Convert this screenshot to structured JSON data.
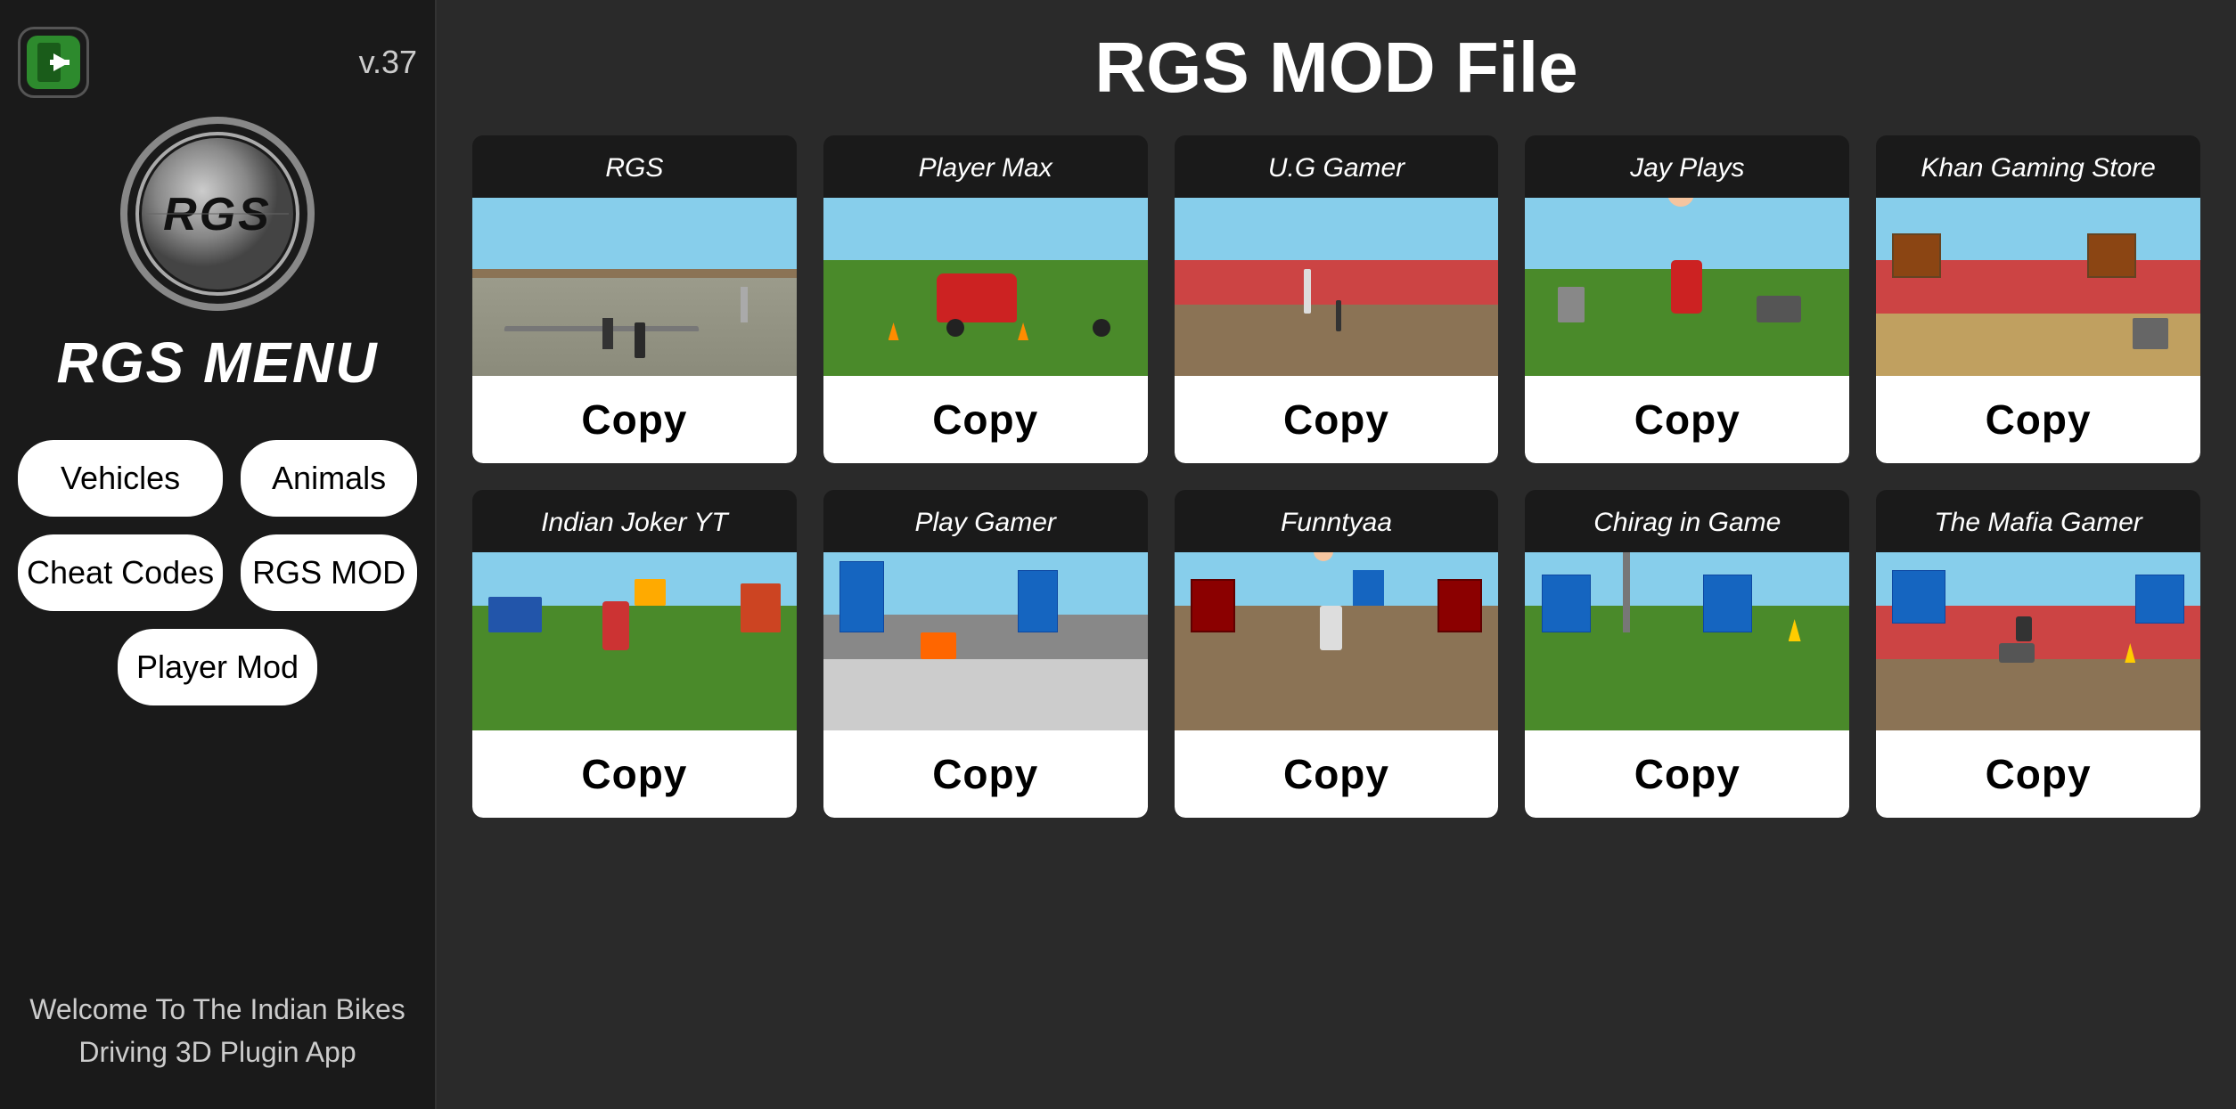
{
  "sidebar": {
    "version": "v.37",
    "menu_title": "RGS MENU",
    "buttons": [
      {
        "label": "Vehicles",
        "id": "vehicles"
      },
      {
        "label": "Animals",
        "id": "animals"
      },
      {
        "label": "Cheat Codes",
        "id": "cheat-codes"
      },
      {
        "label": "RGS MOD",
        "id": "rgs-mod"
      },
      {
        "label": "Player Mod",
        "id": "player-mod"
      }
    ],
    "welcome_text": "Welcome To The Indian Bikes\nDriving 3D Plugin App"
  },
  "main": {
    "title": "RGS MOD File",
    "cards": [
      {
        "id": "rgs",
        "name": "RGS",
        "scene": "scene-rgs",
        "copy_label": "Copy"
      },
      {
        "id": "player-max",
        "name": "Player Max",
        "scene": "scene-playermax",
        "copy_label": "Copy"
      },
      {
        "id": "ug-gamer",
        "name": "U.G Gamer",
        "scene": "scene-uggamer",
        "copy_label": "Copy"
      },
      {
        "id": "jay-plays",
        "name": "Jay Plays",
        "scene": "scene-jayplays",
        "copy_label": "Copy"
      },
      {
        "id": "khan-gaming",
        "name": "Khan Gaming Store",
        "scene": "scene-khangaming",
        "copy_label": "Copy"
      },
      {
        "id": "indian-joker",
        "name": "Indian Joker YT",
        "scene": "scene-indianjoker",
        "copy_label": "Copy"
      },
      {
        "id": "play-gamer",
        "name": "Play Gamer",
        "scene": "scene-playgamer",
        "copy_label": "Copy"
      },
      {
        "id": "funntyaa",
        "name": "Funntyaa",
        "scene": "scene-funntyaa",
        "copy_label": "Copy"
      },
      {
        "id": "chirag-in-game",
        "name": "Chirag in Game",
        "scene": "scene-chiragingame",
        "copy_label": "Copy"
      },
      {
        "id": "mafia-gamer",
        "name": "The Mafia Gamer",
        "scene": "scene-mafiagamer",
        "copy_label": "Copy"
      }
    ]
  }
}
